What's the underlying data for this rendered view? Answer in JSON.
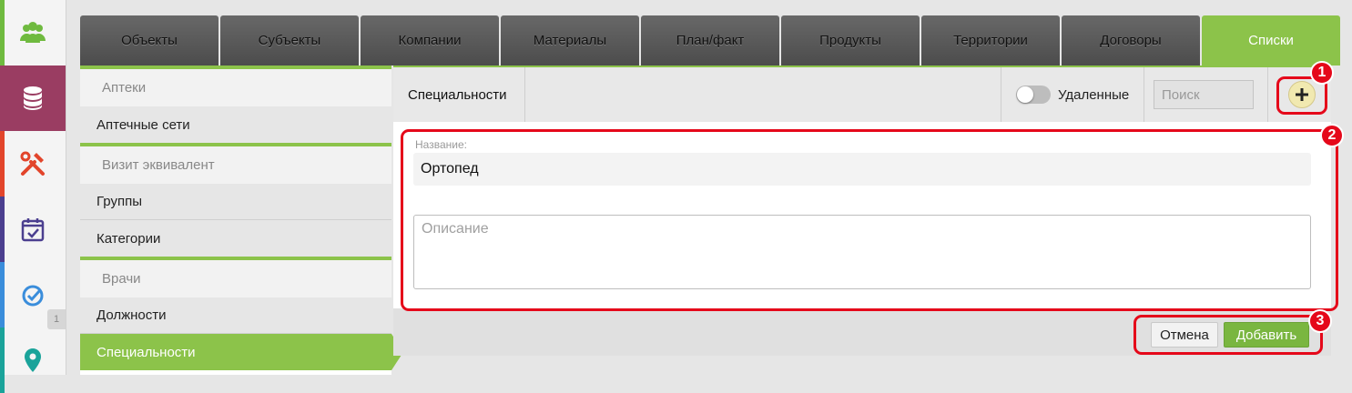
{
  "tabs": [
    {
      "label": "Объекты",
      "active": false
    },
    {
      "label": "Субъекты",
      "active": false
    },
    {
      "label": "Компании",
      "active": false
    },
    {
      "label": "Материалы",
      "active": false
    },
    {
      "label": "План/факт",
      "active": false
    },
    {
      "label": "Продукты",
      "active": false
    },
    {
      "label": "Территории",
      "active": false
    },
    {
      "label": "Договоры",
      "active": false
    },
    {
      "label": "Списки",
      "active": true
    }
  ],
  "sidebar_icons": [
    {
      "name": "users-icon",
      "color": "#6fba3f",
      "bar": "#6fba3f"
    },
    {
      "name": "database-icon",
      "color": "#ffffff",
      "bar": "#9a3d62"
    },
    {
      "name": "tools-icon",
      "color": "#e2452b",
      "bar": "#e2452b"
    },
    {
      "name": "calendar-check-icon",
      "color": "#4b3f8f",
      "bar": "#4b3f8f"
    },
    {
      "name": "check-circle-icon",
      "color": "#3a8ddb",
      "bar": "#3a8ddb"
    },
    {
      "name": "map-pin-icon",
      "color": "#1aa39a",
      "bar": "#1aa39a"
    }
  ],
  "sidebar_badge": "1",
  "list": {
    "sections": [
      {
        "title": "Аптеки",
        "items": [
          "Аптечные сети"
        ]
      },
      {
        "title": "Визит эквивалент",
        "items": [
          "Группы",
          "Категории"
        ]
      },
      {
        "title": "Врачи",
        "items": [
          "Должности",
          "Специальности"
        ]
      }
    ],
    "active_item": "Специальности"
  },
  "header": {
    "title": "Специальности",
    "toggle_label": "Удаленные",
    "toggle_on": false,
    "search_placeholder": "Поиск",
    "add_icon": "plus-icon"
  },
  "form": {
    "name_label": "Название:",
    "name_value": "Ортопед",
    "description_placeholder": "Описание"
  },
  "footer": {
    "cancel_label": "Отмена",
    "add_label": "Добавить"
  },
  "annotations": [
    "1",
    "2",
    "3"
  ],
  "colors": {
    "accent": "#8cc34a",
    "annotation": "#e5081a"
  }
}
